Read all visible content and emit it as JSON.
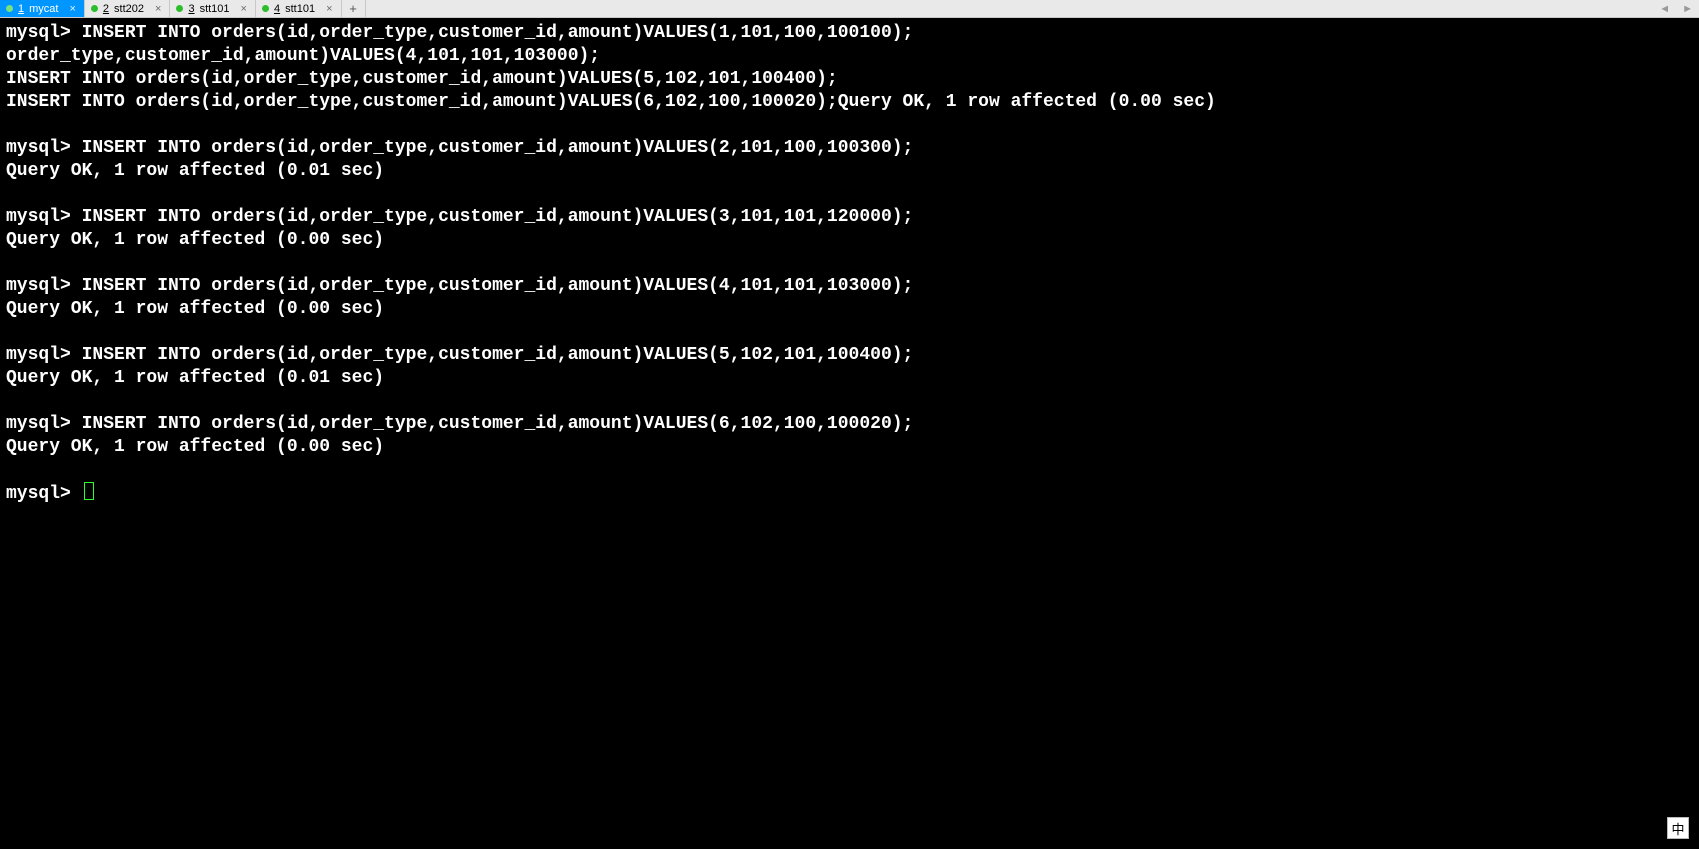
{
  "tabs": [
    {
      "num": "1",
      "label": "mycat",
      "active": true
    },
    {
      "num": "2",
      "label": "stt202",
      "active": false
    },
    {
      "num": "3",
      "label": "stt101",
      "active": false
    },
    {
      "num": "4",
      "label": "stt101",
      "active": false
    }
  ],
  "tab_add_glyph": "+",
  "tab_nav": {
    "left": "◄",
    "right": "►"
  },
  "tab_close_glyph": "×",
  "ime_badge": "中",
  "terminal_lines": [
    "mysql> INSERT INTO orders(id,order_type,customer_id,amount)VALUES(1,101,100,100100);",
    "order_type,customer_id,amount)VALUES(4,101,101,103000);",
    "INSERT INTO orders(id,order_type,customer_id,amount)VALUES(5,102,101,100400);",
    "INSERT INTO orders(id,order_type,customer_id,amount)VALUES(6,102,100,100020);Query OK, 1 row affected (0.00 sec)",
    "",
    "mysql> INSERT INTO orders(id,order_type,customer_id,amount)VALUES(2,101,100,100300);",
    "Query OK, 1 row affected (0.01 sec)",
    "",
    "mysql> INSERT INTO orders(id,order_type,customer_id,amount)VALUES(3,101,101,120000);",
    "Query OK, 1 row affected (0.00 sec)",
    "",
    "mysql> INSERT INTO orders(id,order_type,customer_id,amount)VALUES(4,101,101,103000);",
    "Query OK, 1 row affected (0.00 sec)",
    "",
    "mysql> INSERT INTO orders(id,order_type,customer_id,amount)VALUES(5,102,101,100400);",
    "Query OK, 1 row affected (0.01 sec)",
    "",
    "mysql> INSERT INTO orders(id,order_type,customer_id,amount)VALUES(6,102,100,100020);",
    "Query OK, 1 row affected (0.00 sec)",
    "",
    "mysql> "
  ],
  "prompt_with_cursor_index": 20
}
